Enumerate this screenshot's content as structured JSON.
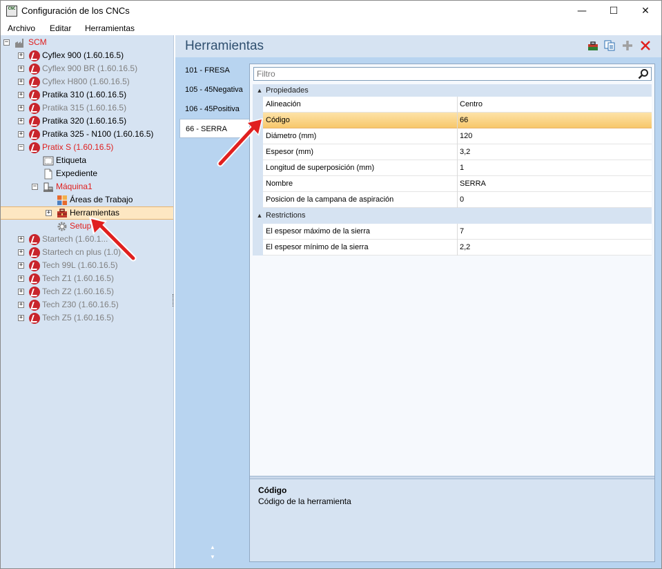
{
  "window": {
    "title": "Configuración de los CNCs",
    "app_icon_text": "CNC",
    "minimize_glyph": "—",
    "maximize_glyph": "☐",
    "close_glyph": "✕"
  },
  "menu": {
    "items": [
      "Archivo",
      "Editar",
      "Herramientas"
    ]
  },
  "tree": {
    "root_label": "SCM",
    "machines": [
      {
        "label": "Cyflex 900 (1.60.16.5)",
        "state": "active"
      },
      {
        "label": "Cyflex 900 BR (1.60.16.5)",
        "state": "inactive"
      },
      {
        "label": "Cyflex H800 (1.60.16.5)",
        "state": "inactive"
      },
      {
        "label": "Pratika 310 (1.60.16.5)",
        "state": "active"
      },
      {
        "label": "Pratika 315 (1.60.16.5)",
        "state": "inactive"
      },
      {
        "label": "Pratika 320 (1.60.16.5)",
        "state": "active"
      },
      {
        "label": "Pratika 325 - N100 (1.60.16.5)",
        "state": "active"
      },
      {
        "label": "Pratix S (1.60.16.5)",
        "state": "red"
      }
    ],
    "pratix_children": {
      "etiqueta": "Etiqueta",
      "expediente": "Expediente",
      "maquina": "Máquina1",
      "areas": "Áreas de Trabajo",
      "herramientas": "Herramientas",
      "setups": "Setups"
    },
    "more_machines": [
      {
        "label": "Startech (1.60.1...",
        "state": "inactive"
      },
      {
        "label": "Startech cn plus (1.0)",
        "state": "inactive"
      },
      {
        "label": "Tech 99L (1.60.16.5)",
        "state": "inactive"
      },
      {
        "label": "Tech Z1 (1.60.16.5)",
        "state": "inactive"
      },
      {
        "label": "Tech Z2 (1.60.16.5)",
        "state": "inactive"
      },
      {
        "label": "Tech Z30 (1.60.16.5)",
        "state": "inactive"
      },
      {
        "label": "Tech Z5 (1.60.16.5)",
        "state": "inactive"
      }
    ]
  },
  "panel": {
    "title": "Herramientas",
    "tool_tabs": [
      "101 - FRESA",
      "105 - 45Negativa",
      "106 - 45Positiva",
      "66 - SERRA"
    ],
    "selected_tab_index": 3,
    "filter_placeholder": "Filtro"
  },
  "properties": {
    "categories": [
      {
        "name": "Propiedades",
        "rows": [
          {
            "name": "Alineación",
            "value": "Centro"
          },
          {
            "name": "Código",
            "value": "66"
          },
          {
            "name": "Diámetro (mm)",
            "value": "120"
          },
          {
            "name": "Espesor (mm)",
            "value": "3,2"
          },
          {
            "name": "Longitud de superposición (mm)",
            "value": "1"
          },
          {
            "name": "Nombre",
            "value": "SERRA"
          },
          {
            "name": "Posicion de la campana de aspiración",
            "value": "0"
          }
        ]
      },
      {
        "name": "Restrictions",
        "rows": [
          {
            "name": "El espesor máximo de la sierra",
            "value": "7"
          },
          {
            "name": "El espesor mínimo de la sierra",
            "value": "2,2"
          }
        ]
      }
    ],
    "selected_row": "Código"
  },
  "description": {
    "title": "Código",
    "text": "Código de la herramienta"
  },
  "colors": {
    "accent_red": "#e0201f",
    "header_blue": "#2f4f6f",
    "selection_orange": "#f7c76b"
  }
}
